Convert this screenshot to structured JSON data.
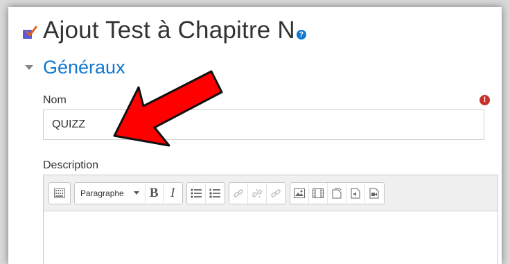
{
  "page": {
    "title": "Ajout Test à Chapitre N"
  },
  "section": {
    "title": "Généraux"
  },
  "name_field": {
    "label": "Nom",
    "value": "QUIZZ",
    "required_glyph": "!"
  },
  "description_field": {
    "label": "Description"
  },
  "editor": {
    "format_label": "Paragraphe",
    "bold_label": "B",
    "italic_label": "I"
  },
  "help": {
    "glyph": "?"
  },
  "colors": {
    "accent": "#1177d1",
    "required": "#c9302c",
    "annotation_arrow": "#ff0000"
  },
  "icons": {
    "quiz": "quiz-checkbox-icon",
    "help": "question-circle-icon",
    "collapse": "caret-down-icon",
    "required": "exclamation-circle-icon",
    "annotation": "red-arrow-annotation"
  }
}
